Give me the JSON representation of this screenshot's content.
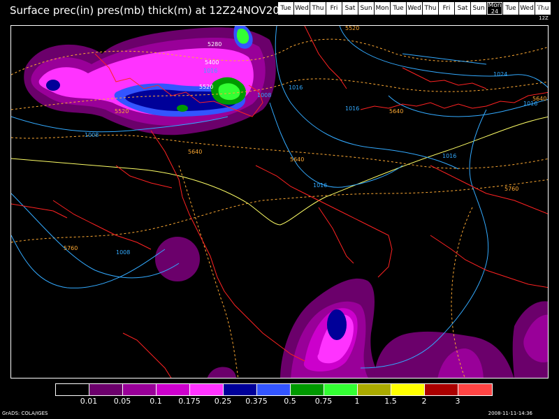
{
  "title": "Surface prec(in) pres(mb) thick(m) at 12Z24NOV2008",
  "day_strip": [
    {
      "label": "Tue"
    },
    {
      "label": "Wed"
    },
    {
      "label": "Thu"
    },
    {
      "label": "Fri"
    },
    {
      "label": "Sat"
    },
    {
      "label": "Sun"
    },
    {
      "label": "Mon"
    },
    {
      "label": "Tue"
    },
    {
      "label": "Wed"
    },
    {
      "label": "Thu"
    },
    {
      "label": "Fri"
    },
    {
      "label": "Sat"
    },
    {
      "label": "Sun"
    },
    {
      "label": "Mon",
      "num": "24",
      "current": true
    },
    {
      "label": "Tue"
    },
    {
      "label": "Wed"
    },
    {
      "label": "Thu"
    }
  ],
  "clock_label": "12Z",
  "legend": {
    "colors": [
      "#000000",
      "#6b006b",
      "#990099",
      "#cc00cc",
      "#ff33ff",
      "#000099",
      "#3355ff",
      "#009900",
      "#33ff33",
      "#aaaa00",
      "#ffff00",
      "#aa0000",
      "#ff4444"
    ],
    "labels": [
      "0.01",
      "0.05",
      "0.1",
      "0.175",
      "0.25",
      "0.375",
      "0.5",
      "0.75",
      "1",
      "1.5",
      "2",
      "3"
    ]
  },
  "contour_labels": {
    "pressure": [
      "1008",
      "1016",
      "1016",
      "1008",
      "1016",
      "1024",
      "1016",
      "1016",
      "1016",
      "1008"
    ],
    "thickness": [
      "5280",
      "5400",
      "5520",
      "5520",
      "5520",
      "5640",
      "5640",
      "5640",
      "5640",
      "5760",
      "5760"
    ]
  },
  "footer": {
    "left": "GrADS: COLA/IGES",
    "right": "2008-11-11-14:36"
  },
  "colors": {
    "pressure_contour": "#33aaff",
    "thickness_low": "#ffff66",
    "thickness_high": "#ffaa33",
    "borders": "#ff2222"
  }
}
